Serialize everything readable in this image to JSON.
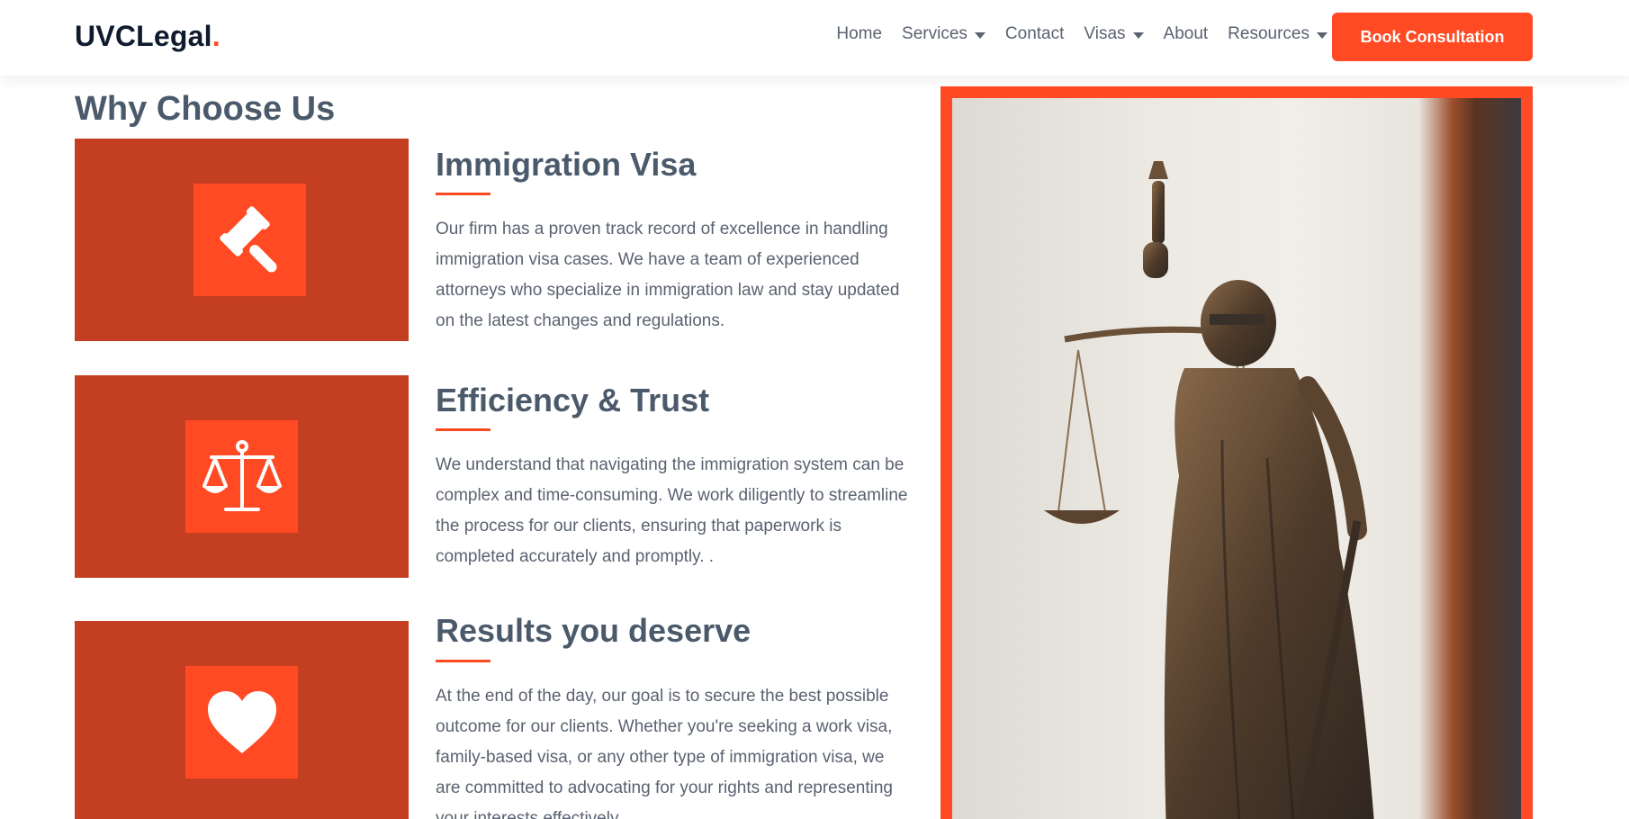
{
  "header": {
    "brand": "UVCLegal",
    "brand_dot": ".",
    "nav": [
      {
        "label": "Home",
        "dropdown": false
      },
      {
        "label": "Services",
        "dropdown": true
      },
      {
        "label": "Contact",
        "dropdown": false
      },
      {
        "label": "Visas",
        "dropdown": true
      },
      {
        "label": "About",
        "dropdown": false
      },
      {
        "label": "Resources",
        "dropdown": true
      }
    ],
    "cta_label": "Book Consultation"
  },
  "main": {
    "title": "Why Choose Us",
    "features": [
      {
        "icon": "gavel-icon",
        "heading": "Immigration Visa",
        "text": "Our firm has a proven track record of excellence in handling immigration visa cases. We have a team of experienced attorneys who specialize in immigration law and stay updated on the latest changes and regulations."
      },
      {
        "icon": "scales-icon",
        "heading": "Efficiency & Trust",
        "text": "We understand that navigating the immigration system can be complex and time-consuming. We work diligently to streamline the process for our clients, ensuring that paperwork is completed accurately and promptly. ."
      },
      {
        "icon": "heart-icon",
        "heading": "Results you deserve",
        "text": "At the end of the day, our goal is to secure the best possible outcome for our clients. Whether you're seeking a work visa, family-based visa, or any other type of immigration visa, we are committed to advocating for your rights and representing your interests effectively."
      }
    ],
    "image": {
      "subject": "lady-justice-statue"
    }
  },
  "colors": {
    "accent": "#ff4a24",
    "box": "#c43e21",
    "heading": "#4b5a6b",
    "brand": "#0f1b2d"
  }
}
